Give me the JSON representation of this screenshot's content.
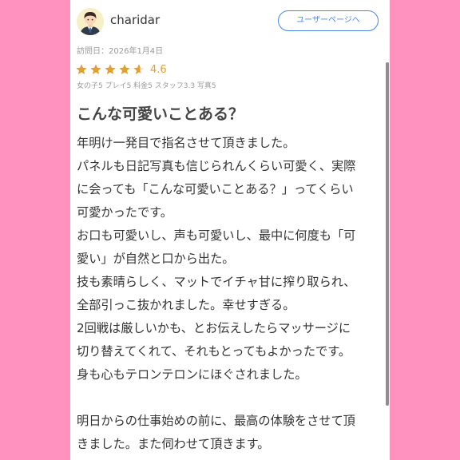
{
  "user": {
    "name": "charidar",
    "user_page_label": "ユーザーページへ"
  },
  "review": {
    "visit_date": "訪問日：2026年1月4日",
    "rating": "4.6",
    "rating_fraction": 0.92,
    "sub_ratings": "女の子5 プレイ5 料金5 スタッフ3.3 写真5",
    "title": "こんな可愛いことある？",
    "lines": [
      "年明け一発目で指名させて頂きました。",
      "パネルも日記写真も信じられんくらい可愛く、実際",
      "に会っても「こんな可愛いことある？」ってくらい",
      "可愛かったです。",
      "お口も可愛いし、声も可愛いし、最中に何度も「可",
      "愛い」が自然と口から出た。",
      "技も素晴らしく、マットでイチャ甘に搾り取られ、",
      "全部引っこ抜かれました。幸せすぎる。",
      "2回戦は厳しいかも、とお伝えしたらマッサージに",
      "切り替えてくれて、それもとってもよかったです。",
      "身も心もテロンテロンにほぐされました。",
      "",
      "明日からの仕事始めの前に、最高の体験をさせて頂",
      "きました。また伺わせて頂きます。"
    ]
  },
  "colors": {
    "background": "#ff92be",
    "card": "#ffffff",
    "accent_blue": "#4a86e8",
    "star_gold": "#e0a12f",
    "star_empty": "#e6e6e6"
  },
  "icons": {
    "avatar": "user-avatar-icon",
    "star": "star-icon"
  }
}
